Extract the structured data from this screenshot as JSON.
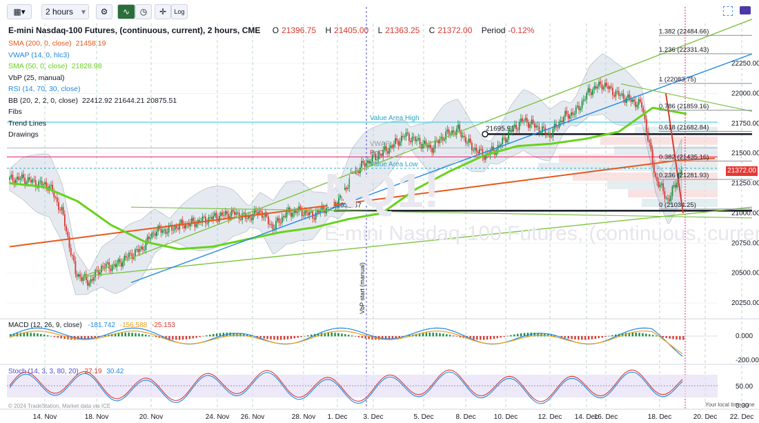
{
  "toolbar": {
    "bar_icon": "bar-chart-icon",
    "interval": "2 hours",
    "settings_icon": "gear-icon",
    "indicators_icon": "indicator-icon",
    "replay_icon": "clock-icon",
    "draw_icon": "crosshair-icon",
    "log_label": "Log"
  },
  "header": {
    "symbol": "E-mini Nasdaq-100 Futures, (continuous, current), 2 hours, CME",
    "o_label": "O",
    "o_value": "21396.75",
    "h_label": "H",
    "h_value": "21405.00",
    "l_label": "L",
    "l_value": "21363.25",
    "c_label": "C",
    "c_value": "21372.00",
    "period_label": "Period",
    "period_value": "-0.12%"
  },
  "legend": [
    {
      "label": "SMA (200, 0, close)",
      "value": "21458.19",
      "color": "#e8571c"
    },
    {
      "label": "VWAP (14, 0, hlc3)",
      "value": "",
      "color": "#1e88e5"
    },
    {
      "label": "SMA (50, 0, close)",
      "value": "21828.98",
      "color": "#66d31b"
    },
    {
      "label": "VbP (25, manual)",
      "value": "",
      "color": "#131722"
    },
    {
      "label": "RSI (14, 70, 30, close)",
      "value": "",
      "color": "#1e88e5"
    },
    {
      "label": "BB (20, 2, 2, 0, close)",
      "value": "22412.92  21644.21  20875.51",
      "color": "#131722"
    },
    {
      "label": "Fibs",
      "value": "",
      "color": "#131722"
    },
    {
      "label": "Trend Lines",
      "value": "",
      "color": "#131722"
    },
    {
      "label": "Drawings",
      "value": "",
      "color": "#131722"
    }
  ],
  "annotations": {
    "value_area_high": "Value Area High",
    "vwap": "VWAP",
    "poc": "PoC",
    "value_area_low": "Value Area Low",
    "level_high": "21695.91",
    "level_low": "21032.67",
    "vbp_start": "VbP start (manual)",
    "watermark": "NQ1!",
    "watermark_sub": "E-mini Nasdaq-100 Futures, (continuous, current)"
  },
  "fib_levels": [
    {
      "label": "1.382 (22484.66)",
      "price": 22484.66
    },
    {
      "label": "1.236 (22331.43)",
      "price": 22331.43
    },
    {
      "label": "1 (22083.75)",
      "price": 22083.75
    },
    {
      "label": "0.786 (21859.16)",
      "price": 21859.16
    },
    {
      "label": "0.618 (21682.84)",
      "price": 21682.84
    },
    {
      "label": "0.382 (21435.16)",
      "price": 21435.16
    },
    {
      "label": "0.236 (21281.93)",
      "price": 21281.93
    },
    {
      "label": "0 (21034.25)",
      "price": 21034.25
    }
  ],
  "price_badge": "21372.00",
  "macd": {
    "title": "MACD (12, 26, 9, close)",
    "v1": "-181.742",
    "v2": "-156.588",
    "v3": "-25.153",
    "axis": [
      "0.000",
      "-200.000"
    ]
  },
  "stoch": {
    "title": "Stoch (14, 3, 3, 80, 20)",
    "v1": "27.19",
    "v2": "30.42",
    "axis": [
      "50.00",
      "0.00"
    ]
  },
  "footer": {
    "copyright": "© 2024 TradeStation, Market data via ICE",
    "timezone": "Your local time zone"
  },
  "colors": {
    "up": "#1a8f3f",
    "down": "#d8392f",
    "sma200": "#e8571c",
    "sma50": "#66d31b",
    "vwap": "#1e88e5",
    "trend": "#7cc243",
    "cyan": "#26c6da",
    "pink": "#e91e63",
    "bb_fill": "#b6c6d8",
    "badge": "#e53935"
  },
  "chart_data": {
    "type": "candlestick",
    "y_axis_ticks": [
      22250,
      22000,
      21750,
      21500,
      21250,
      21000,
      20750,
      20500,
      20250
    ],
    "y_axis_labels": [
      "22250.00",
      "22000.00",
      "21750.00",
      "21500.00",
      "21250.00",
      "21000.00",
      "20750.00",
      "20500.00",
      "20250.00"
    ],
    "ylim": [
      20100,
      22700
    ],
    "x_axis_labels": [
      "14. Nov",
      "18. Nov",
      "20. Nov",
      "24. Nov",
      "26. Nov",
      "28. Nov",
      "1. Dec",
      "3. Dec",
      "5. Dec",
      "8. Dec",
      "10. Dec",
      "12. Dec",
      "14. Dec",
      "16. Dec",
      "18. Dec",
      "20. Dec",
      "22. Dec"
    ],
    "close_path": [
      21280,
      21290,
      21250,
      21230,
      21000,
      20500,
      20420,
      20550,
      20560,
      20640,
      20700,
      20850,
      20860,
      20900,
      20920,
      20950,
      20980,
      21000,
      20960,
      21020,
      20880,
      21000,
      21020,
      20980,
      21050,
      21100,
      21320,
      21420,
      21480,
      21560,
      21650,
      21600,
      21540,
      21650,
      21700,
      21560,
      21480,
      21540,
      21680,
      21780,
      21720,
      21650,
      21800,
      21850,
      22020,
      22080,
      22000,
      21950,
      21900,
      21300,
      21100,
      21372
    ],
    "sma200_path": [
      20720,
      20760,
      20800,
      20840,
      20880,
      20920,
      20960,
      21000,
      21040,
      21080,
      21120,
      21160,
      21200,
      21240,
      21280,
      21320,
      21360,
      21400,
      21440,
      21458
    ],
    "sma50_path": [
      21250,
      21220,
      21100,
      20900,
      20760,
      20700,
      20720,
      20780,
      20840,
      20880,
      20950,
      21000,
      21200,
      21350,
      21480,
      21560,
      21580,
      21620,
      21680,
      21880,
      21829
    ],
    "macd_values": [
      -181.742,
      -156.588,
      -25.153
    ],
    "stoch_values": [
      27.19,
      30.42
    ]
  }
}
